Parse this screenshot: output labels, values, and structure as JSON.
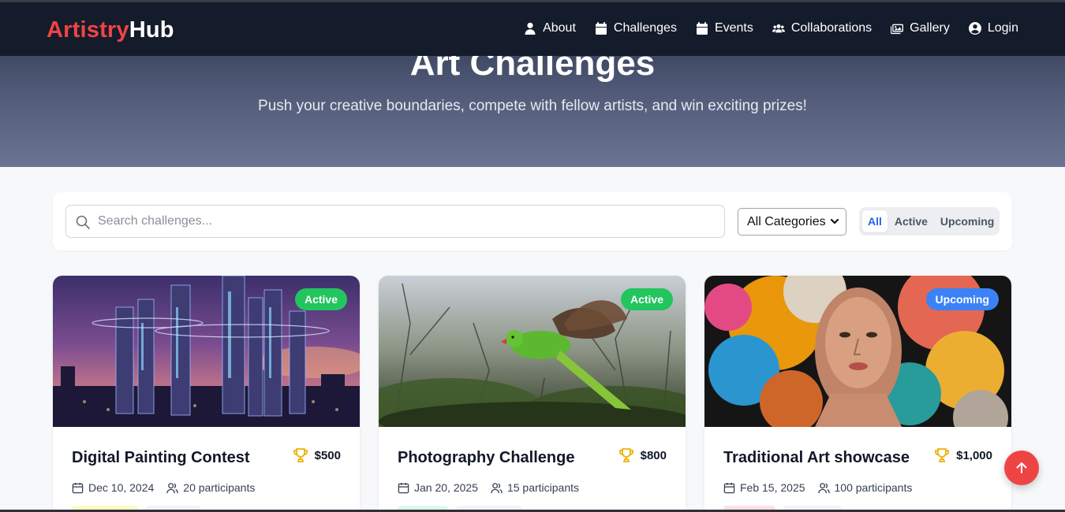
{
  "brand": {
    "part1": "Artistry",
    "part2": "Hub"
  },
  "nav": {
    "items": [
      {
        "label": "About",
        "icon": "user-icon"
      },
      {
        "label": "Challenges",
        "icon": "calendar-icon"
      },
      {
        "label": "Events",
        "icon": "calendar-icon"
      },
      {
        "label": "Collaborations",
        "icon": "users-icon"
      },
      {
        "label": "Gallery",
        "icon": "images-icon"
      },
      {
        "label": "Login",
        "icon": "user-circle-icon"
      }
    ]
  },
  "hero": {
    "title": "Art Challenges",
    "subtitle": "Push your creative boundaries, compete with fellow artists, and win exciting prizes!"
  },
  "filters": {
    "search_placeholder": "Search challenges...",
    "category_selected": "All Categories",
    "status_tabs": [
      "All",
      "Active",
      "Upcoming"
    ],
    "status_selected": "All"
  },
  "cards": [
    {
      "title": "Digital Painting Contest",
      "prize": "$500",
      "status": "Active",
      "date": "Dec 10, 2024",
      "participants": "20 participants",
      "status_color": "#22c55e",
      "image": "futuristic-city"
    },
    {
      "title": "Photography Challenge",
      "prize": "$800",
      "status": "Active",
      "date": "Jan 20, 2025",
      "participants": "15 participants",
      "status_color": "#22c55e",
      "image": "green-parrot"
    },
    {
      "title": "Traditional Art showcase",
      "prize": "$1,000",
      "status": "Upcoming",
      "date": "Feb 15, 2025",
      "participants": "100 participants",
      "status_color": "#3b82f6",
      "image": "colorful-portrait"
    }
  ],
  "colors": {
    "brand_red": "#ef4444",
    "nav_bg": "#141b2b",
    "active_blue": "#2563eb",
    "trophy": "#eab308"
  }
}
